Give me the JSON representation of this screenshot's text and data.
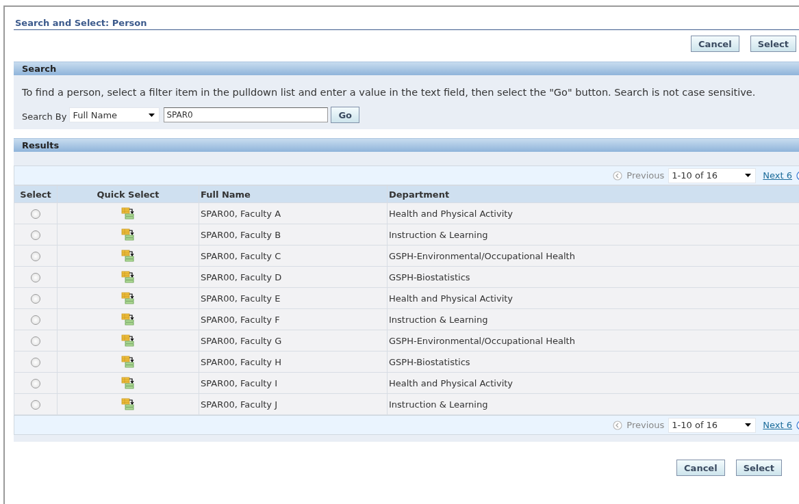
{
  "title": "Search and Select: Person",
  "top_buttons": [
    "Cancel",
    "Select"
  ],
  "search": {
    "header": "Search",
    "instructions": "To find a person, select a filter item in the pulldown list and enter a value in the text field, then select the \"Go\" button. Search is not case sensitive.",
    "search_by_label": "Search By",
    "filter": "Full Name",
    "value": "SPAR0",
    "go_button": "Go"
  },
  "results": {
    "header": "Results",
    "pager_top": {
      "previous": "Previous",
      "range": "1-10 of 16",
      "next": "Next 6"
    },
    "columns": [
      "Select",
      "Quick Select",
      "Full Name",
      "Department"
    ],
    "rows": [
      {
        "selected": false,
        "full_name": "SPAR00, Faculty A",
        "department": "Health and Physical Activity"
      },
      {
        "selected": false,
        "full_name": "SPAR00, Faculty B",
        "department": "Instruction & Learning"
      },
      {
        "selected": false,
        "full_name": "SPAR00, Faculty C",
        "department": "GSPH-Environmental/Occupational Health"
      },
      {
        "selected": false,
        "full_name": "SPAR00, Faculty D",
        "department": "GSPH-Biostatistics"
      },
      {
        "selected": false,
        "full_name": "SPAR00, Faculty E",
        "department": "Health and Physical Activity"
      },
      {
        "selected": false,
        "full_name": "SPAR00, Faculty F",
        "department": "Instruction & Learning"
      },
      {
        "selected": false,
        "full_name": "SPAR00, Faculty G",
        "department": "GSPH-Environmental/Occupational Health"
      },
      {
        "selected": false,
        "full_name": "SPAR00, Faculty H",
        "department": "GSPH-Biostatistics"
      },
      {
        "selected": false,
        "full_name": "SPAR00, Faculty I",
        "department": "Health and Physical Activity"
      },
      {
        "selected": false,
        "full_name": "SPAR00, Faculty J",
        "department": "Instruction & Learning"
      }
    ],
    "pager_bottom": {
      "previous": "Previous",
      "range": "1-10 of 16",
      "next": "Next 6"
    }
  },
  "bottom_buttons": [
    "Cancel",
    "Select"
  ]
}
